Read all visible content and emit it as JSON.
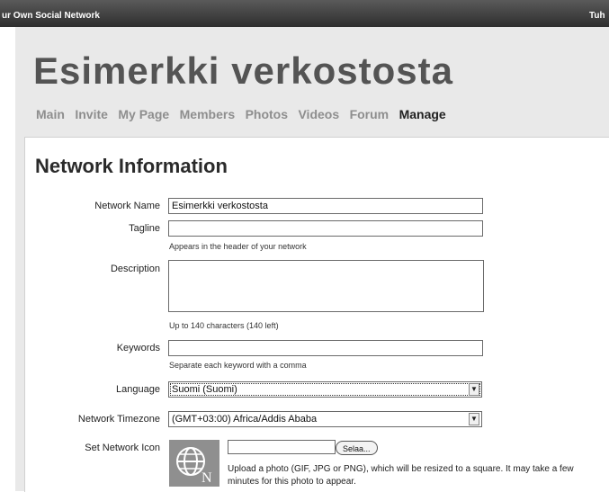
{
  "topbar": {
    "left_text": "ur Own Social Network",
    "right_text": "Tuh"
  },
  "header": {
    "site_title": "Esimerkki verkostosta"
  },
  "nav": [
    "Main",
    "Invite",
    "My Page",
    "Members",
    "Photos",
    "Videos",
    "Forum",
    "Manage"
  ],
  "nav_active": "Manage",
  "form": {
    "title": "Network Information",
    "network_name": {
      "label": "Network Name",
      "value": "Esimerkki verkostosta"
    },
    "tagline": {
      "label": "Tagline",
      "value": "",
      "hint": "Appears in the header of your network"
    },
    "description": {
      "label": "Description",
      "value": "",
      "hint": "Up to 140 characters (140 left)"
    },
    "keywords": {
      "label": "Keywords",
      "value": "",
      "hint": "Separate each keyword with a comma"
    },
    "language": {
      "label": "Language",
      "selected": "Suomi (Suomi)"
    },
    "timezone": {
      "label": "Network Timezone",
      "selected": "(GMT+03:00) Africa/Addis Ababa"
    },
    "icon": {
      "label": "Set Network Icon",
      "browse_label": "Selaa...",
      "icon_name": "globe-network-icon",
      "hint": "Upload a photo (GIF, JPG or PNG), which will be resized to a square. It may take a few minutes for this photo to appear."
    }
  },
  "colors": {
    "topbar": "#3a3a3a",
    "page_bg": "#e9e9e9",
    "nav_inactive": "#8e8e8e",
    "nav_active": "#222222"
  }
}
